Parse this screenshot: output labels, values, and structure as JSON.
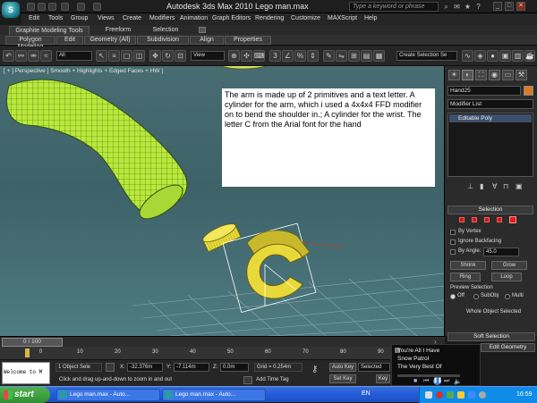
{
  "app": {
    "title": "Autodesk 3ds Max  2010    Lego man.max",
    "search_placeholder": "Type a keyword or phrase"
  },
  "menu": [
    "Edit",
    "Tools",
    "Group",
    "Views",
    "Create",
    "Modifiers",
    "Animation",
    "Graph Editors",
    "Rendering",
    "Customize",
    "MAXScript",
    "Help"
  ],
  "ribbon": {
    "tabs": [
      "Graphite Modeling Tools",
      "Freeform",
      "Selection"
    ],
    "panels": [
      "Polygon Modeling",
      "Edit",
      "Geometry (All)",
      "Subdivision",
      "Align",
      "Properties"
    ]
  },
  "toolbar": {
    "filter_value": "All",
    "ref_coord_value": "View",
    "named_selection_placeholder": "Create Selection Se"
  },
  "viewport": {
    "label": "[ + ] Perspective ] Smooth + Highlights + Edged Faces + HW ]",
    "note": "The arm is made up of 2 primitives and a text letter. A cylinder for the arm, which i used a 4x4x4 FFD modifier on to bend the shoulder in.; A cylinder for the wrist.  The letter C from the Arial font for the hand"
  },
  "command_panel": {
    "object_name": "Hand25",
    "modifier_list": "Modifier List",
    "stack_item": "Editable Poly",
    "selection_header": "Selection",
    "by_vertex": "By Vertex",
    "ignore_backfacing": "Ignore Backfacing",
    "by_angle": "By Angle:",
    "angle_value": "45.0",
    "shrink": "Shrink",
    "grow": "Grow",
    "ring": "Ring",
    "loop": "Loop",
    "preview_selection": "Preview Selection",
    "preview_off": "Off",
    "preview_subobj": "SubObj",
    "preview_multi": "Multi",
    "whole_object": "Whole Object Selected",
    "soft_selection": "Soft Selection",
    "edit_geometry": "Edit Geometry"
  },
  "timeline": {
    "slider": "0 / 100",
    "ticks": [
      "0",
      "10",
      "20",
      "30",
      "40",
      "50",
      "60",
      "70",
      "80",
      "90",
      "100"
    ]
  },
  "status": {
    "maxscript_line": "Welcome to M",
    "selection_info": "1 Object Sele",
    "x_label": "X:",
    "x_value": "-32.376m",
    "y_label": "Y:",
    "y_value": "-7.114m",
    "z_label": "Z:",
    "z_value": "0.0m",
    "grid": "Grid = 0.254m",
    "auto_key": "Auto Key",
    "selected": "Selected",
    "set_key": "Set Key",
    "key_filters": "Key F",
    "prompt": "Click and drag up-and-down to zoom in and out",
    "add_time_tag": "Add Time Tag"
  },
  "media_player": {
    "line1": "You're All I Have",
    "line2": "Snow Patrol",
    "line3": "The Very Best Of"
  },
  "taskbar": {
    "start": "start",
    "task1": "Lego man.max - Auto...",
    "task2": "Lego man.max - Auto...",
    "lang": "EN",
    "clock": "16:59"
  },
  "colors": {
    "viewport": "#456a70",
    "mesh": "#b7e63a",
    "wire": "#2f4f12",
    "selected": "#ffffff",
    "taskbar": "#245edb",
    "start": "#3a9b3a"
  }
}
